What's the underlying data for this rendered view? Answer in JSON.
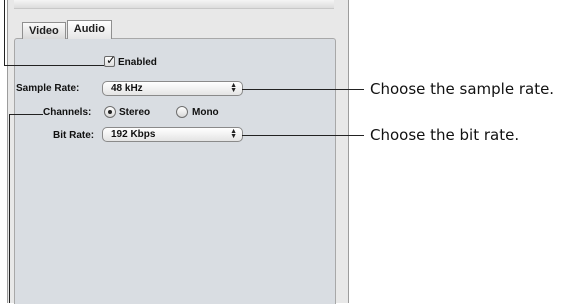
{
  "tabs": [
    {
      "label": "Video",
      "active": false
    },
    {
      "label": "Audio",
      "active": true
    }
  ],
  "enabled": {
    "label": "Enabled",
    "checked": true
  },
  "sample_rate": {
    "label": "Sample Rate:",
    "value": "48 kHz"
  },
  "channels": {
    "label": "Channels:",
    "options": [
      {
        "label": "Stereo",
        "selected": true
      },
      {
        "label": "Mono",
        "selected": false
      }
    ]
  },
  "bit_rate": {
    "label": "Bit Rate:",
    "value": "192 Kbps"
  },
  "callouts": {
    "sample_rate": "Choose the sample rate.",
    "bit_rate": "Choose the bit rate."
  }
}
